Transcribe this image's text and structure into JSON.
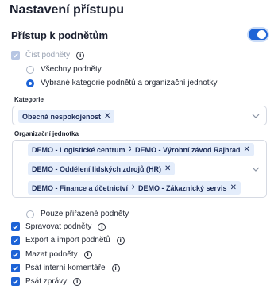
{
  "section": {
    "title": "Nastavení přístupu"
  },
  "access": {
    "label": "Přístup k podnětům",
    "enabled": true
  },
  "read": {
    "label": "Číst podněty",
    "checked": true,
    "disabled": true,
    "info_icon": "info-icon"
  },
  "scope": {
    "options": [
      {
        "label": "Všechny podněty",
        "selected": false
      },
      {
        "label": "Vybrané kategorie podnětů a organizační jednotky",
        "selected": true
      },
      {
        "label": "Pouze přiřazené podněty",
        "selected": false
      }
    ]
  },
  "categories": {
    "label": "Kategorie",
    "chips": [
      {
        "label": "Obecná nespokojenost"
      }
    ]
  },
  "org_units": {
    "label": "Organizační jednotka",
    "chips": [
      {
        "label": "DEMO - Logistické centrum"
      },
      {
        "label": "DEMO - Výrobní závod Rajhrad"
      },
      {
        "label": "DEMO - Oddělení lidských zdrojů (HR)"
      },
      {
        "label": "DEMO - Finance a účetnictví"
      },
      {
        "label": "DEMO - Zákaznický servis"
      }
    ]
  },
  "permissions": [
    {
      "label": "Spravovat podněty",
      "checked": true
    },
    {
      "label": "Export a import podnětů",
      "checked": true
    },
    {
      "label": "Mazat podněty",
      "checked": true
    },
    {
      "label": "Psát interní komentáře",
      "checked": true
    },
    {
      "label": "Psát zprávy",
      "checked": true
    }
  ],
  "colors": {
    "accent": "#1d63d6",
    "chip_bg": "#e4edfb",
    "border": "#d6dae3"
  }
}
